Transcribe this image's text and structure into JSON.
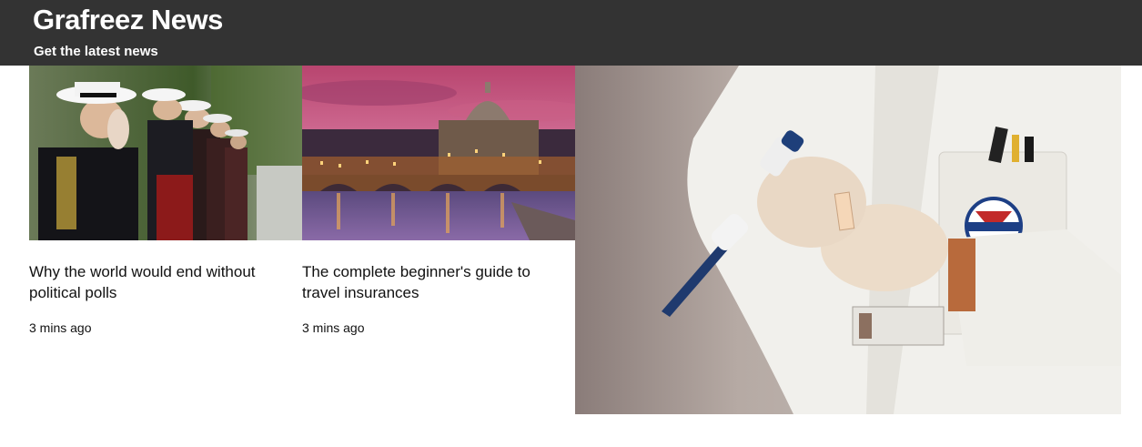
{
  "header": {
    "title": "Grafreez News",
    "tagline": "Get the latest news"
  },
  "articles": [
    {
      "title": "Why the world would end without political polls",
      "time": "3 mins ago",
      "image_icon": "marines-saluting-photo"
    },
    {
      "title": "The complete beginner's guide to travel insurances",
      "time": "3 mins ago",
      "image_icon": "rome-skyline-photo"
    }
  ],
  "feature": {
    "image_icon": "lab-technician-pipette-photo"
  },
  "colors": {
    "header_bg": "#333333",
    "header_text": "#ffffff",
    "body_text": "#111111"
  }
}
